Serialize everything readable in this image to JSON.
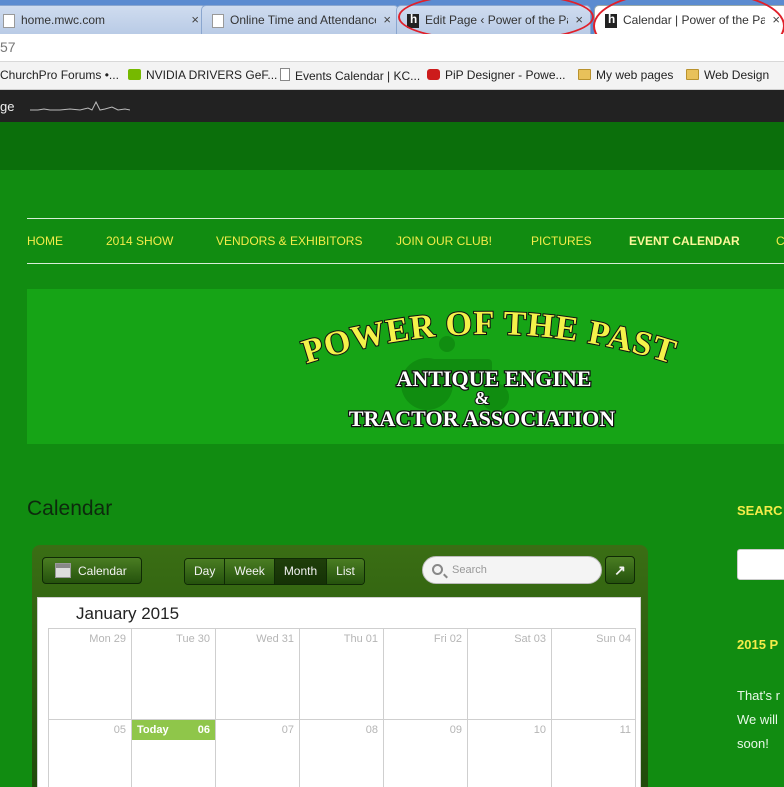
{
  "browser": {
    "tabs": [
      {
        "title": "home.mwc.com",
        "close": "×",
        "icon": "page-icon"
      },
      {
        "title": "Online Time and Attendance",
        "close": "×",
        "icon": "page-icon"
      },
      {
        "title": "Edit Page ‹ Power of the Past",
        "close": "×",
        "icon": "hosting-favicon"
      },
      {
        "title": "Calendar | Power of the Past",
        "close": "×",
        "icon": "hosting-favicon",
        "active": true
      }
    ],
    "address_fragment": "57",
    "bookmarks": [
      {
        "label": "ChurchPro Forums •...",
        "icon": "none"
      },
      {
        "label": "NVIDIA DRIVERS GeF...",
        "icon": "nvidia-icon"
      },
      {
        "label": "Events Calendar | KC...",
        "icon": "page-icon"
      },
      {
        "label": "PiP Designer - Powe...",
        "icon": "youtube-icon"
      },
      {
        "label": "My web pages",
        "icon": "folder-icon"
      },
      {
        "label": "Web Design",
        "icon": "folder-icon"
      }
    ]
  },
  "admin_bar": {
    "label": "ge"
  },
  "nav": {
    "items": [
      {
        "label": "HOME"
      },
      {
        "label": "2014 SHOW"
      },
      {
        "label": "VENDORS & EXHIBITORS"
      },
      {
        "label": "JOIN OUR CLUB!"
      },
      {
        "label": "PICTURES"
      },
      {
        "label": "EVENT CALENDAR",
        "current": true
      },
      {
        "label": "C"
      }
    ]
  },
  "banner": {
    "line1": "POWER OF THE PAST",
    "line2": "ANTIQUE ENGINE",
    "line3": "&",
    "line4": "TRACTOR ASSOCIATION"
  },
  "page": {
    "title": "Calendar"
  },
  "calendar": {
    "calendar_button": "Calendar",
    "views": [
      "Day",
      "Week",
      "Month",
      "List"
    ],
    "selected_view": "Month",
    "search_placeholder": "Search",
    "expand_icon": "↗",
    "month_title": "January 2015",
    "weeks": [
      [
        "Mon 29",
        "Tue 30",
        "Wed 31",
        "Thu 01",
        "Fri 02",
        "Sat 03",
        "Sun 04"
      ],
      [
        "05",
        "06",
        "07",
        "08",
        "09",
        "10",
        "11"
      ]
    ],
    "today_label": "Today",
    "today_index": [
      1,
      1
    ],
    "colors": {
      "today": "#8fc64a",
      "header_top": "#3a6e14",
      "header_bottom": "#1f4a0a"
    }
  },
  "sidebar": {
    "search_title": "SEARC",
    "widget_title": "2015 P",
    "text_lines": [
      "That's r",
      "We will",
      "soon!"
    ]
  },
  "colors": {
    "page_bg": "#118c11",
    "nav_text": "#f4ec4a",
    "banner_text": "#f4f24a"
  }
}
